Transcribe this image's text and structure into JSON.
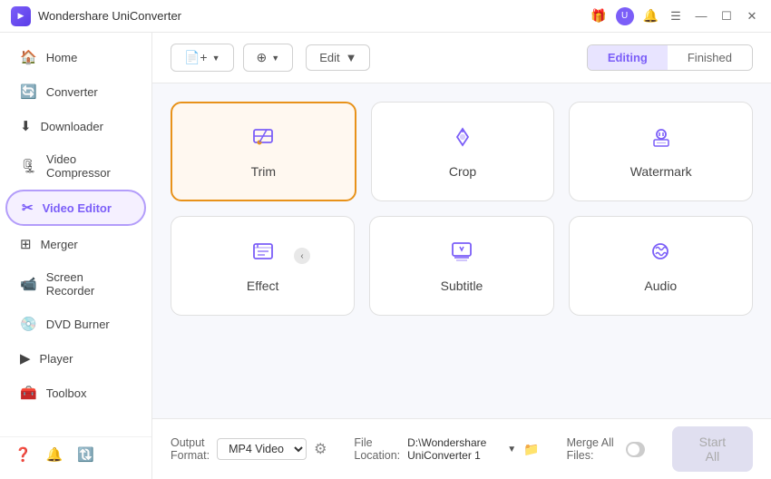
{
  "titleBar": {
    "appName": "Wondershare UniConverter",
    "controls": {
      "minimize": "—",
      "maximize": "☐",
      "close": "✕"
    }
  },
  "sidebar": {
    "items": [
      {
        "id": "home",
        "label": "Home",
        "icon": "🏠"
      },
      {
        "id": "converter",
        "label": "Converter",
        "icon": "🔄"
      },
      {
        "id": "downloader",
        "label": "Downloader",
        "icon": "⬇"
      },
      {
        "id": "video-compressor",
        "label": "Video Compressor",
        "icon": "🗜"
      },
      {
        "id": "video-editor",
        "label": "Video Editor",
        "icon": "✂",
        "active": true
      },
      {
        "id": "merger",
        "label": "Merger",
        "icon": "⊞"
      },
      {
        "id": "screen-recorder",
        "label": "Screen Recorder",
        "icon": "📹"
      },
      {
        "id": "dvd-burner",
        "label": "DVD Burner",
        "icon": "💿"
      },
      {
        "id": "player",
        "label": "Player",
        "icon": "▶"
      },
      {
        "id": "toolbox",
        "label": "Toolbox",
        "icon": "🧰"
      }
    ],
    "footer": {
      "help": "?",
      "bell": "🔔",
      "refresh": "🔃"
    }
  },
  "toolbar": {
    "addBtn": "+",
    "addLabel": "Add",
    "rotateLabel": "Add",
    "editLabel": "Edit",
    "tabs": {
      "editing": "Editing",
      "finished": "Finished",
      "active": "editing"
    }
  },
  "cards": {
    "row1": [
      {
        "id": "trim",
        "label": "Trim",
        "icon": "trim",
        "active": true
      },
      {
        "id": "crop",
        "label": "Crop",
        "icon": "crop",
        "active": false
      },
      {
        "id": "watermark",
        "label": "Watermark",
        "icon": "watermark",
        "active": false
      }
    ],
    "row2": [
      {
        "id": "effect",
        "label": "Effect",
        "icon": "effect",
        "active": false
      },
      {
        "id": "subtitle",
        "label": "Subtitle",
        "icon": "subtitle",
        "active": false
      },
      {
        "id": "audio",
        "label": "Audio",
        "icon": "audio",
        "active": false
      }
    ]
  },
  "bottomBar": {
    "outputFormatLabel": "Output Format:",
    "outputFormatValue": "MP4 Video",
    "fileLocationLabel": "File Location:",
    "fileLocationValue": "D:\\Wondershare UniConverter 1",
    "mergeAllLabel": "Merge All Files:",
    "startAllLabel": "Start All"
  }
}
